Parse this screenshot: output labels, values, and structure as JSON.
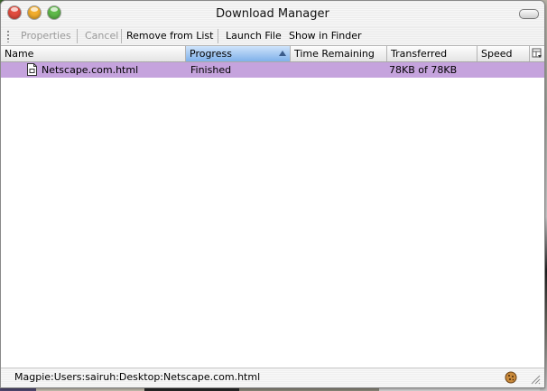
{
  "window": {
    "title": "Download Manager"
  },
  "toolbar": {
    "properties": "Properties",
    "cancel": "Cancel",
    "remove_from_list": "Remove from List",
    "launch_file": "Launch File",
    "show_in_finder": "Show in Finder"
  },
  "columns": {
    "name": "Name",
    "progress": "Progress",
    "time_remaining": "Time Remaining",
    "transferred": "Transferred",
    "speed": "Speed"
  },
  "downloads": [
    {
      "name": "Netscape.com.html",
      "progress": "Finished",
      "time_remaining": "",
      "transferred": "78KB of 78KB",
      "speed": ""
    }
  ],
  "status": {
    "path": "Magpie:Users:sairuh:Desktop:Netscape.com.html"
  },
  "colors": {
    "selected_row": "#c5a3dd",
    "sorted_header": "#7fb1ea"
  },
  "icons": [
    "file-html-icon",
    "column-picker-icon",
    "cookie-icon",
    "resize-grip-icon",
    "toolbar-toggle-icon"
  ]
}
